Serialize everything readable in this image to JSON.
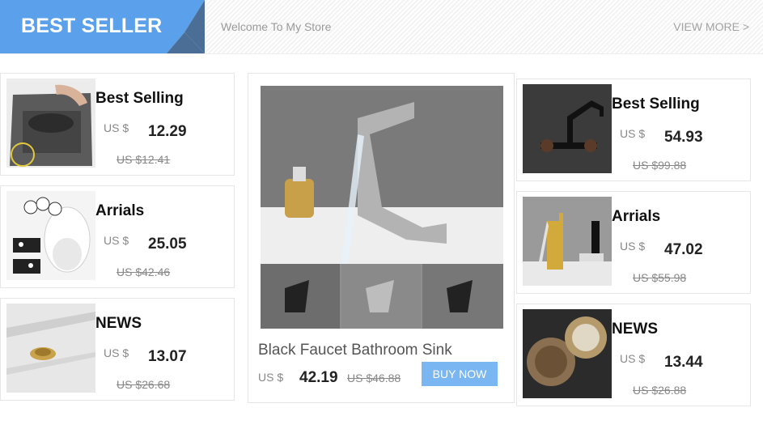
{
  "banner": {
    "badge": "BEST SELLER",
    "welcome": "Welcome To My Store",
    "view_more": "VIEW MORE >"
  },
  "left_products": [
    {
      "title": "Best Selling",
      "currency": "US $",
      "price": "12.29",
      "old_price": "US $12.41",
      "image": "square-floor-drain"
    },
    {
      "title": "Arrials",
      "currency": "US $",
      "price": "25.05",
      "old_price": "US $42.46",
      "image": "toilet-seat-cow-print"
    },
    {
      "title": "NEWS",
      "currency": "US $",
      "price": "13.07",
      "old_price": "US $26.68",
      "image": "brass-sink-drain-marble"
    }
  ],
  "featured": {
    "title": "Black Faucet Bathroom Sink",
    "currency": "US $",
    "price": "42.19",
    "old_price": "US $46.88",
    "buy_label": "BUY NOW",
    "image": "waterfall-basin-faucet"
  },
  "right_products": [
    {
      "title": "Best Selling",
      "currency": "US $",
      "price": "54.93",
      "old_price": "US $99.88",
      "image": "wall-mount-black-faucet"
    },
    {
      "title": "Arrials",
      "currency": "US $",
      "price": "47.02",
      "old_price": "US $55.98",
      "image": "gold-faucet"
    },
    {
      "title": "NEWS",
      "currency": "US $",
      "price": "13.44",
      "old_price": "US $26.88",
      "image": "bronze-drain-covers"
    }
  ],
  "colors": {
    "accent": "#5aa0ea",
    "accent_dark": "#4b6e96",
    "button": "#7ab6f2"
  }
}
